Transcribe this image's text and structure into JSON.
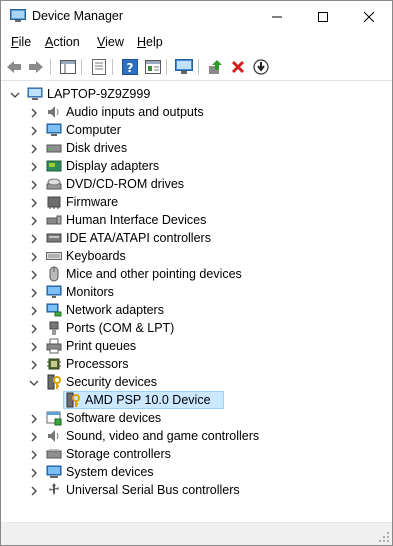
{
  "window": {
    "title": "Device Manager"
  },
  "menu": {
    "items": [
      {
        "label": "File"
      },
      {
        "label": "Action"
      },
      {
        "label": "View"
      },
      {
        "label": "Help"
      }
    ]
  },
  "tree": {
    "root": {
      "label": "LAPTOP-9Z9Z999",
      "expanded": true
    },
    "categories": [
      {
        "label": "Audio inputs and outputs",
        "icon": "speaker-icon"
      },
      {
        "label": "Computer",
        "icon": "computer-icon"
      },
      {
        "label": "Disk drives",
        "icon": "disk-drive-icon"
      },
      {
        "label": "Display adapters",
        "icon": "display-adapter-icon"
      },
      {
        "label": "DVD/CD-ROM drives",
        "icon": "dvd-drive-icon"
      },
      {
        "label": "Firmware",
        "icon": "firmware-icon"
      },
      {
        "label": "Human Interface Devices",
        "icon": "hid-icon"
      },
      {
        "label": "IDE ATA/ATAPI controllers",
        "icon": "ide-controller-icon"
      },
      {
        "label": "Keyboards",
        "icon": "keyboard-icon"
      },
      {
        "label": "Mice and other pointing devices",
        "icon": "mouse-icon"
      },
      {
        "label": "Monitors",
        "icon": "monitor-icon"
      },
      {
        "label": "Network adapters",
        "icon": "network-adapter-icon"
      },
      {
        "label": "Ports (COM & LPT)",
        "icon": "port-icon"
      },
      {
        "label": "Print queues",
        "icon": "printer-icon"
      },
      {
        "label": "Processors",
        "icon": "processor-icon"
      },
      {
        "label": "Security devices",
        "icon": "security-device-icon",
        "expanded": true,
        "children": [
          {
            "label": "AMD PSP 10.0 Device",
            "icon": "security-device-icon",
            "selected": true
          }
        ]
      },
      {
        "label": "Software devices",
        "icon": "software-device-icon"
      },
      {
        "label": "Sound, video and game controllers",
        "icon": "speaker-icon"
      },
      {
        "label": "Storage controllers",
        "icon": "storage-controller-icon"
      },
      {
        "label": "System devices",
        "icon": "system-device-icon"
      },
      {
        "label": "Universal Serial Bus controllers",
        "icon": "usb-icon"
      }
    ]
  },
  "colors": {
    "selection": "#cce8ff",
    "selection_border": "#99d1ff",
    "accent": "#1e90ff"
  }
}
